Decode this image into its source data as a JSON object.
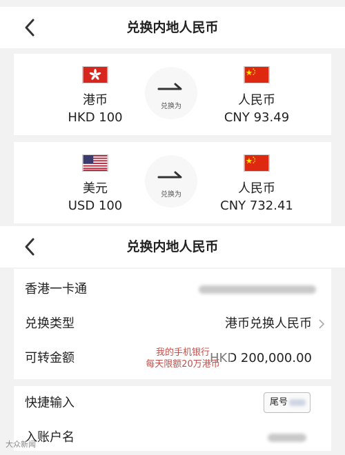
{
  "nav1": {
    "title": "兑换内地人民币"
  },
  "nav2": {
    "title": "兑换内地人民币"
  },
  "exchange": {
    "arrow_label": "兑换为",
    "cards": [
      {
        "from": {
          "name": "港币",
          "amount": "HKD 100",
          "flag": "hk-flag-icon"
        },
        "to": {
          "name": "人民币",
          "amount": "CNY 93.49",
          "flag": "cn-flag-icon"
        }
      },
      {
        "from": {
          "name": "美元",
          "amount": "USD 100",
          "flag": "us-flag-icon"
        },
        "to": {
          "name": "人民币",
          "amount": "CNY 732.41",
          "flag": "cn-flag-icon"
        }
      }
    ]
  },
  "form": {
    "rows": [
      {
        "label": "香港一卡通",
        "value": ""
      },
      {
        "label": "兑换类型",
        "value": "港币兑换人民币"
      },
      {
        "label": "可转金额",
        "value": "HKD 200,000.00"
      }
    ],
    "stamp_line1": "我的手机银行",
    "stamp_line2": "每天限额20万港币"
  },
  "form2": {
    "rows": [
      {
        "label": "快捷输入",
        "tail_label": "尾号"
      },
      {
        "label": "入账户名"
      }
    ]
  },
  "watermark": "大众新闻",
  "colors": {
    "stamp": "#c0504d",
    "background": "#f2f2f2"
  }
}
